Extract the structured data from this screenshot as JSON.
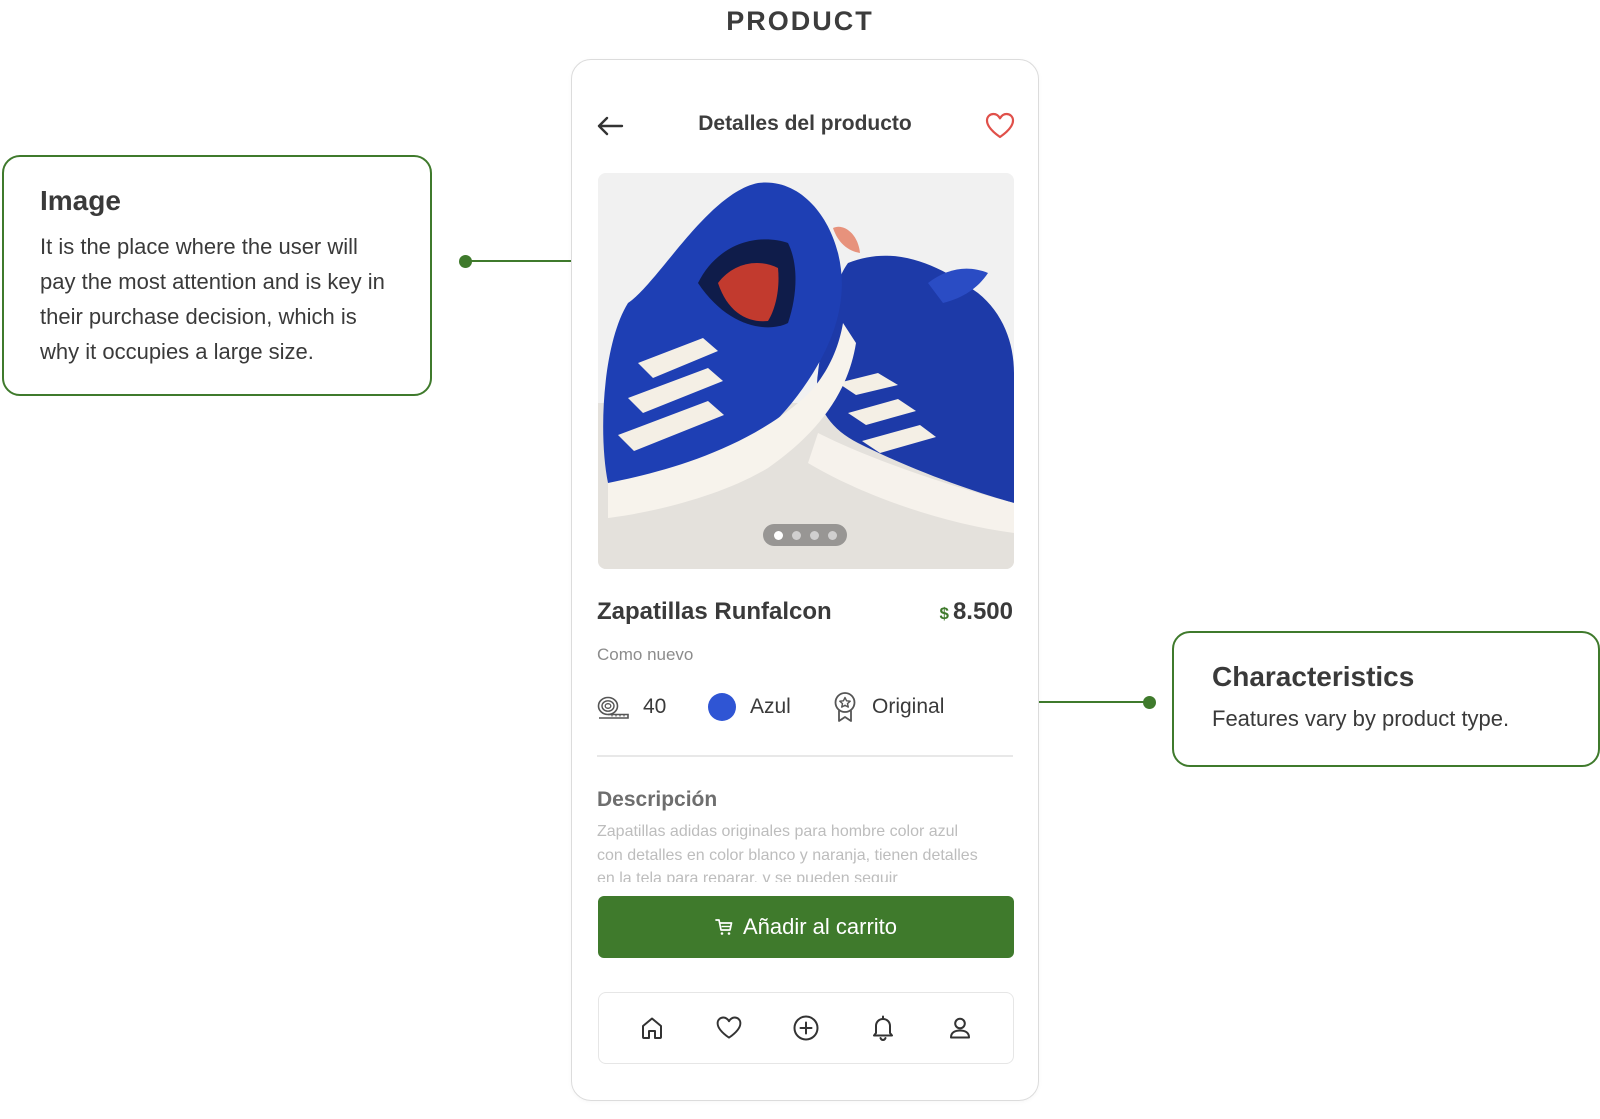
{
  "page": {
    "title": "PRODUCT"
  },
  "annotations": {
    "image": {
      "title": "Image",
      "text": "It is the place where the user will pay the most attention and is key in their purchase decision, which is why it occupies a large size."
    },
    "characteristics": {
      "title": "Characteristics",
      "text": "Features vary by product type."
    }
  },
  "header": {
    "title": "Detalles del producto",
    "back_icon": "arrow-left-icon",
    "fav_icon": "heart-outline-icon"
  },
  "gallery": {
    "image": "blue-running-shoes-photo",
    "total_images": 4,
    "active_index": 0
  },
  "product": {
    "name": "Zapatillas Runfalcon",
    "currency": "$",
    "price": "8.500",
    "condition": "Como nuevo",
    "attributes": {
      "size": "40",
      "color": "Azul",
      "authenticity": "Original"
    },
    "swatch_color": "#2f55d4",
    "description_title": "Descripción",
    "description": "Zapatillas adidas originales para hombre color azul con detalles en color blanco y naranja, tienen detalles en la tela para reparar, y se pueden seguir"
  },
  "actions": {
    "add_to_cart": "Añadir al carrito"
  },
  "bottom_nav": [
    "home-icon",
    "heart-icon",
    "plus-circle-icon",
    "bell-icon",
    "user-icon"
  ],
  "colors": {
    "accent": "#3f7a2c",
    "favorite": "#e0504a"
  }
}
